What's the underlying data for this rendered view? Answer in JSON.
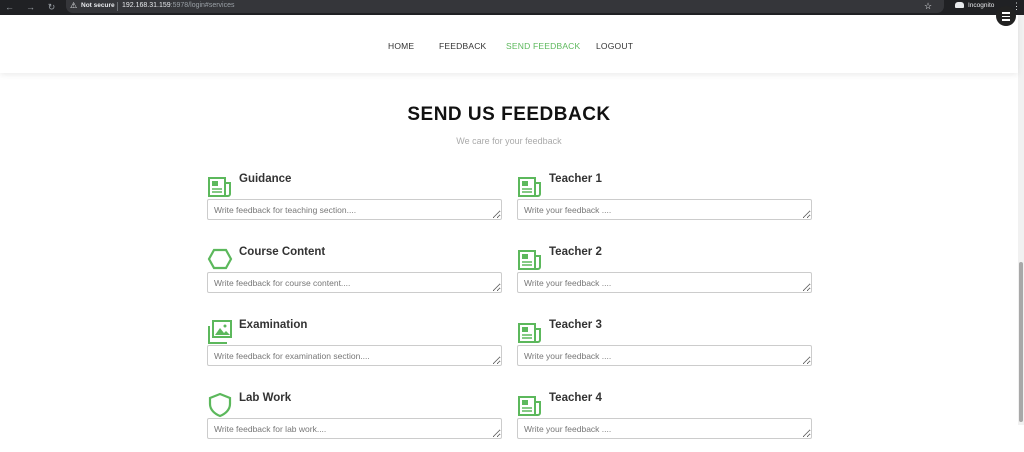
{
  "browser": {
    "security_label": "Not secure",
    "url_host": "192.168.31.159",
    "url_path": ":5978/login#services",
    "incognito_label": "Incognito"
  },
  "nav": {
    "items": [
      {
        "label": "HOME",
        "active": false
      },
      {
        "label": "FEEDBACK",
        "active": false
      },
      {
        "label": "SEND FEEDBACK",
        "active": true
      },
      {
        "label": "LOGOUT",
        "active": false
      }
    ]
  },
  "section": {
    "title": "SEND US FEEDBACK",
    "subtitle": "We care for your feedback"
  },
  "feedback": {
    "left": [
      {
        "label": "Guidance",
        "icon": "newspaper-icon",
        "placeholder": "Write feedback for teaching section...."
      },
      {
        "label": "Course Content",
        "icon": "hexagon-icon",
        "placeholder": "Write feedback for course content...."
      },
      {
        "label": "Examination",
        "icon": "image-icon",
        "placeholder": "Write feedback for examination section...."
      },
      {
        "label": "Lab Work",
        "icon": "shield-icon",
        "placeholder": "Write feedback for lab work...."
      }
    ],
    "right": [
      {
        "label": "Teacher 1",
        "icon": "newspaper-icon",
        "placeholder": "Write your feedback ...."
      },
      {
        "label": "Teacher 2",
        "icon": "newspaper-icon",
        "placeholder": "Write your feedback ...."
      },
      {
        "label": "Teacher 3",
        "icon": "newspaper-icon",
        "placeholder": "Write your feedback ...."
      },
      {
        "label": "Teacher 4",
        "icon": "newspaper-icon",
        "placeholder": "Write your feedback ...."
      }
    ]
  },
  "colors": {
    "accent": "#5cb85c",
    "icon": "#5cb85c"
  }
}
